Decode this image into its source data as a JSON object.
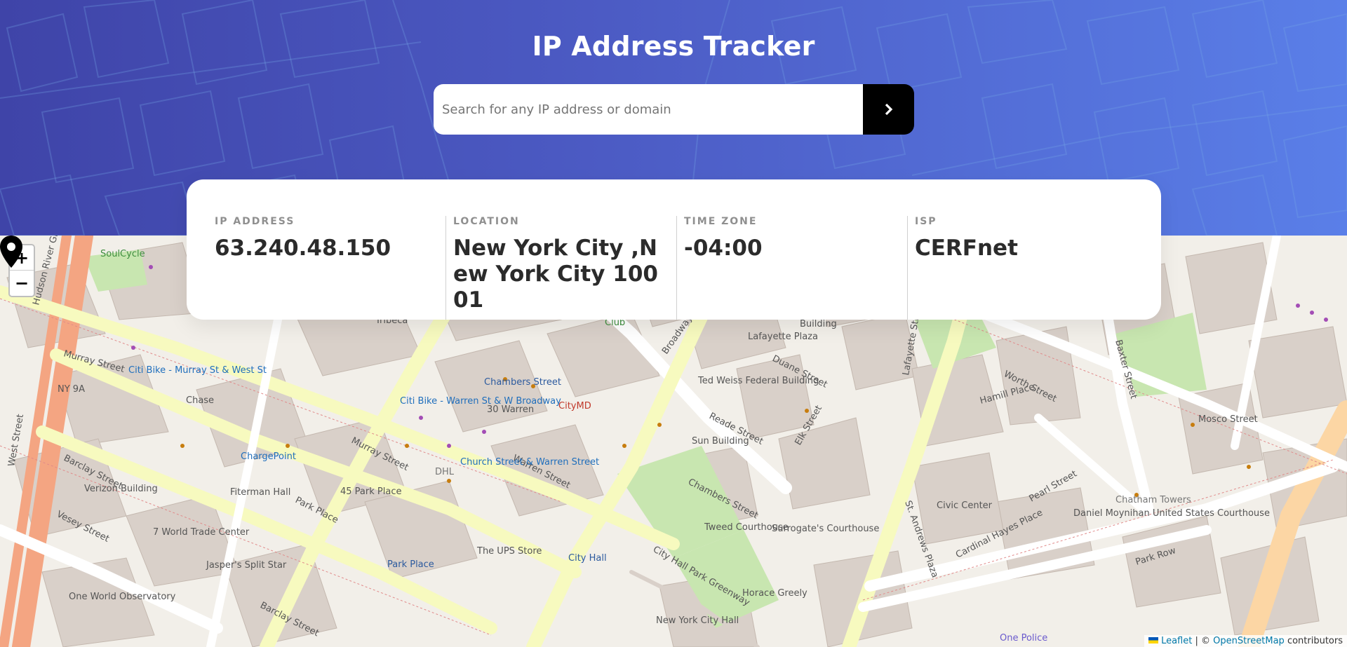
{
  "app": {
    "title": "IP Address Tracker"
  },
  "search": {
    "placeholder": "Search for any IP address or domain",
    "value": "",
    "button_icon": "chevron-right-icon"
  },
  "info": {
    "ip": {
      "label": "IP ADDRESS",
      "value": "63.240.48.150"
    },
    "location": {
      "label": "LOCATION",
      "value": "New York City ,New York City 10001"
    },
    "timezone": {
      "label": "TIME ZONE",
      "value": "-04:00"
    },
    "isp": {
      "label": "ISP",
      "value": "CERFnet"
    }
  },
  "map": {
    "zoom_in": "+",
    "zoom_out": "−",
    "marker_icon": "location-pin-icon",
    "labels": {
      "tribeca": "Tribeca",
      "lafayette_plaza": "Lafayette Plaza",
      "duane_street": "Duane Street",
      "ted_weiss": "Ted Weiss Federal Building",
      "reade_street": "Reade Street",
      "sun_building": "Sun Building",
      "chambers_street": "Chambers Street",
      "chambers_street_2": "Chambers Street",
      "murray_street": "Murray Street",
      "warren_street": "Warren Street",
      "barclay_street": "Barclay Street",
      "park_place": "Park Place",
      "vesey_street": "Vesey Street",
      "broadway": "Broadway",
      "city_hall": "City Hall",
      "tweed": "Tweed Courthouse",
      "surrogates": "Surrogate's Courthouse",
      "civic_center": "Civic Center",
      "worth_street": "Worth Street",
      "hamill_place": "Hamill Place",
      "mosco_street": "Mosco Street",
      "pearl_street": "Pearl Street",
      "cardinal_hayes": "Cardinal Hayes Place",
      "park_row": "Park Row",
      "daniel_moynihan": "Daniel Moynihan United States Courthouse",
      "verizon": "Verizon Building",
      "fiterman": "Fiterman Hall",
      "world_trade": "7 World Trade Center",
      "one_world": "One World Observatory",
      "west_street": "West Street",
      "ny9a": "NY 9A",
      "hudson_river": "Hudson River Greenway",
      "citymd": "CityMD",
      "chargepoint": "ChargePoint",
      "ups_store": "The UPS Store",
      "chase": "Chase",
      "horace_greely": "Horace Greely",
      "ny_city_hall": "New York City Hall",
      "one_police": "One Police",
      "city_hall_park_greenway": "City Hall Park Greenway",
      "st_andrews": "St. Andrews Plaza",
      "elk_street": "Elk Street",
      "baxter_street": "Baxter Street",
      "lafayette_street": "Lafayette Street",
      "soulcycle": "SoulCycle",
      "jaspers": "Jasper's Split Star",
      "citibike_murray": "Citi Bike - Murray St & West St",
      "citibike_warren": "Citi Bike - Warren St & W Broadway",
      "citibike_church": "Church Street & Warren Street",
      "park_place_label": "Park Place",
      "chatham_towers": "Chatham Towers",
      "forty_five_park": "45 Park Place",
      "thirty_warren": "30 Warren",
      "building": "Building",
      "dhl": "DHL",
      "club": "Club"
    },
    "attribution": {
      "leaflet": "Leaflet",
      "separator": "| ©",
      "osm": "OpenStreetMap",
      "suffix": "contributors"
    }
  }
}
